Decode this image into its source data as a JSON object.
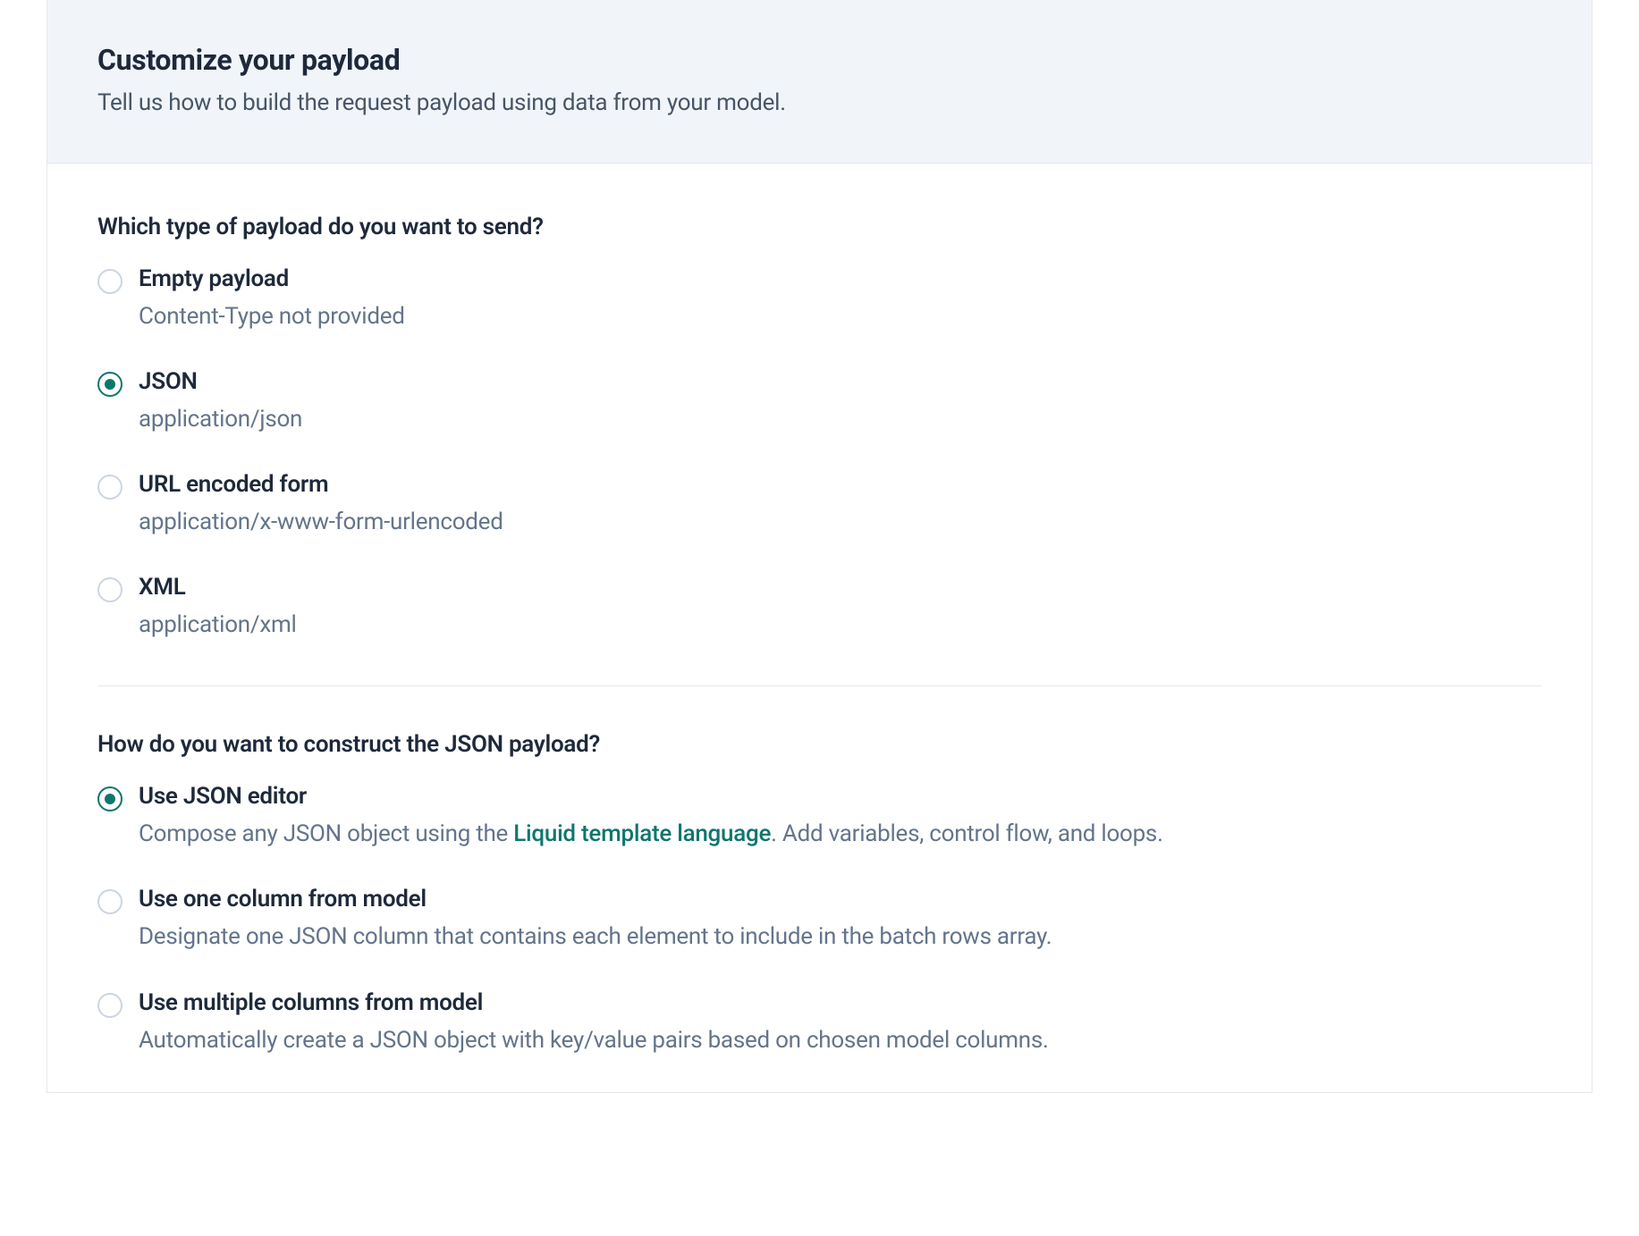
{
  "header": {
    "title": "Customize your payload",
    "subtitle": "Tell us how to build the request payload using data from your model."
  },
  "payload_type": {
    "question": "Which type of payload do you want to send?",
    "options": [
      {
        "title": "Empty payload",
        "desc": "Content-Type not provided",
        "selected": false
      },
      {
        "title": "JSON",
        "desc": "application/json",
        "selected": true
      },
      {
        "title": "URL encoded form",
        "desc": "application/x-www-form-urlencoded",
        "selected": false
      },
      {
        "title": "XML",
        "desc": "application/xml",
        "selected": false
      }
    ]
  },
  "json_construct": {
    "question": "How do you want to construct the JSON payload?",
    "options": [
      {
        "title": "Use JSON editor",
        "desc_prefix": "Compose any JSON object using the ",
        "link_text": "Liquid template language",
        "desc_suffix": ". Add variables, control flow, and loops.",
        "selected": true
      },
      {
        "title": "Use one column from model",
        "desc": "Designate one JSON column that contains each element to include in the batch rows array.",
        "selected": false
      },
      {
        "title": "Use multiple columns from model",
        "desc": "Automatically create a JSON object with key/value pairs based on chosen model columns.",
        "selected": false
      }
    ]
  }
}
